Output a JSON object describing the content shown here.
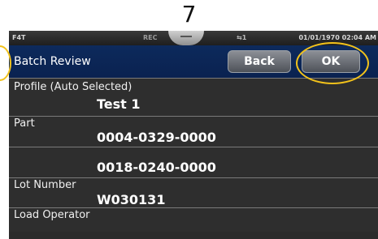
{
  "callout_number": "7",
  "status_bar": {
    "app": "F4T",
    "rec": "REC",
    "usb": "1",
    "datetime": "01/01/1970 02:04 AM"
  },
  "header": {
    "title": "Batch Review",
    "back_label": "Back",
    "ok_label": "OK"
  },
  "fields": [
    {
      "label": "Profile (Auto Selected)",
      "value": "Test 1"
    },
    {
      "label": "Part",
      "value": "0004-0329-0000"
    },
    {
      "label": "",
      "value": "0018-0240-0000"
    },
    {
      "label": "Lot Number",
      "value": "W030131"
    },
    {
      "label": "Load Operator",
      "value": ""
    }
  ],
  "colors": {
    "header_bg": "#0d2a5c",
    "highlight_ring": "#f2c21b"
  }
}
